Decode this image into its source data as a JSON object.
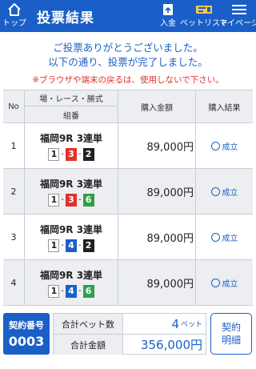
{
  "header": {
    "title": "投票結果",
    "home_label": "トップ",
    "deposit_label": "入金",
    "betlist_label": "ベットリスト",
    "mypage_label": "マイページ"
  },
  "messages": {
    "line1": "ご投票ありがとうございました。",
    "line2": "以下の通り、投票が完了しました。",
    "warning": "※ブラウザや端末の戻るは、使用しないで下さい。"
  },
  "table": {
    "col_no": "No",
    "col_bet_top": "場・レース・勝式",
    "col_bet_bottom": "組番",
    "col_amount": "購入金額",
    "col_result": "購入結果",
    "rows": [
      {
        "no": "1",
        "race": "福岡9R 3連単",
        "n1": "1",
        "n2": "3",
        "n3": "2",
        "amount": "89,000円",
        "result": "成立"
      },
      {
        "no": "2",
        "race": "福岡9R 3連単",
        "n1": "1",
        "n2": "3",
        "n3": "6",
        "amount": "89,000円",
        "result": "成立"
      },
      {
        "no": "3",
        "race": "福岡9R 3連単",
        "n1": "1",
        "n2": "4",
        "n3": "2",
        "amount": "89,000円",
        "result": "成立"
      },
      {
        "no": "4",
        "race": "福岡9R 3連単",
        "n1": "1",
        "n2": "4",
        "n3": "6",
        "amount": "89,000円",
        "result": "成立"
      }
    ]
  },
  "footer": {
    "contract_label": "契約番号",
    "contract_no": "0003",
    "total_bets_label": "合計ベット数",
    "total_bets_value": "4",
    "total_bets_unit": "ベット",
    "total_amount_label": "合計金額",
    "total_amount_value": "356,000円",
    "detail_line1": "契約",
    "detail_line2": "明細"
  },
  "colors": {
    "brand_blue": "#1a5fc7",
    "warning_red": "#e0312a",
    "boat1": "#ffffff",
    "boat2": "#222222",
    "boat3": "#e0312a",
    "boat4": "#1a5fc7",
    "boat6": "#2fa04a"
  }
}
